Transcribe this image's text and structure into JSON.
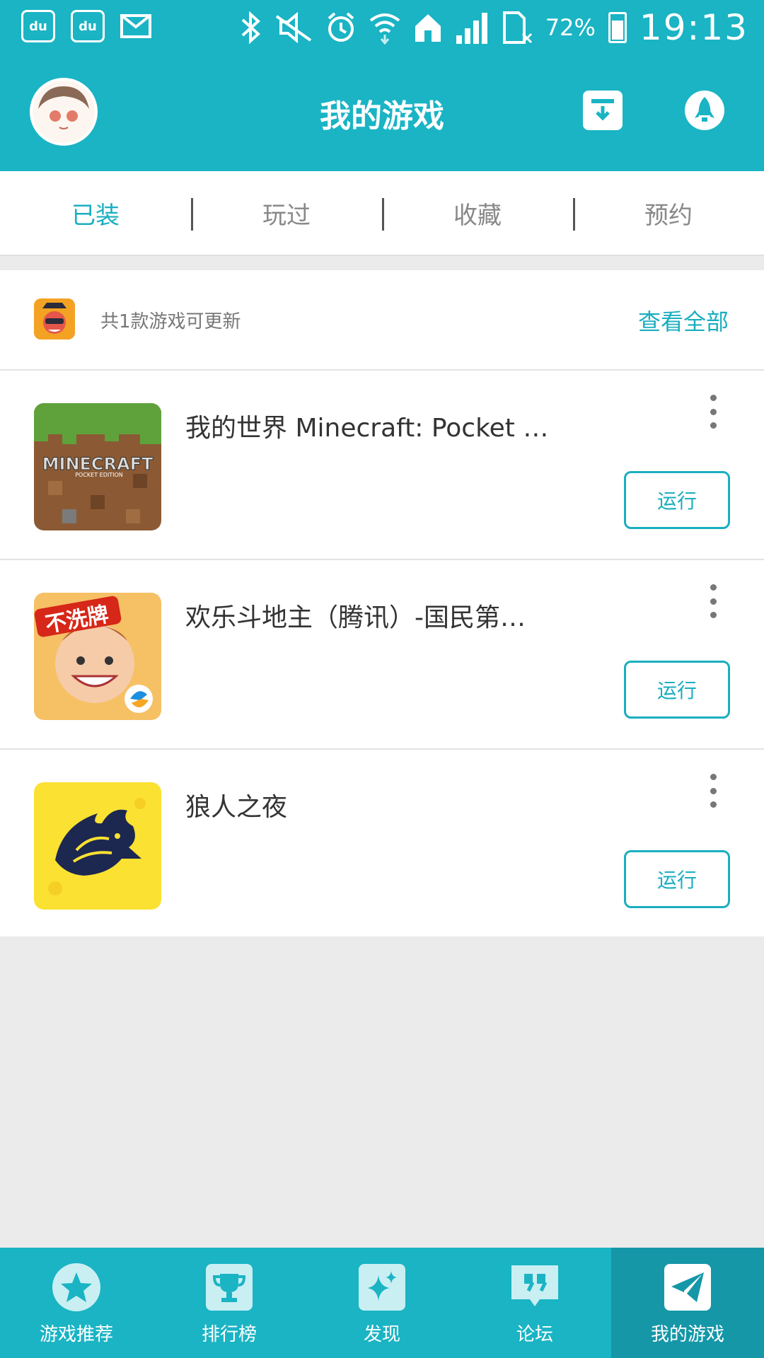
{
  "status_bar": {
    "app_icon_1": "du",
    "app_icon_2": "du",
    "battery_pct": "72%",
    "time": "19:13",
    "icons": [
      "baidu-icon",
      "baidu-icon",
      "mail-icon",
      "bluetooth-icon",
      "mute-icon",
      "alarm-icon",
      "wifi-icon",
      "home-icon",
      "signal-icon",
      "sim-icon",
      "battery-icon"
    ]
  },
  "header": {
    "title": "我的游戏"
  },
  "tabs": [
    {
      "label": "已装",
      "active": true
    },
    {
      "label": "玩过",
      "active": false
    },
    {
      "label": "收藏",
      "active": false
    },
    {
      "label": "预约",
      "active": false
    }
  ],
  "update_banner": {
    "text": "共1款游戏可更新",
    "link": "查看全部"
  },
  "games": [
    {
      "name": "我的世界 Minecraft: Pocket …",
      "run_label": "运行",
      "icon_text": "MINECRAFT",
      "icon_subtext": "POCKET EDITION"
    },
    {
      "name": "欢乐斗地主（腾讯）-国民第…",
      "run_label": "运行",
      "icon_text": "不洗牌"
    },
    {
      "name": "狼人之夜",
      "run_label": "运行"
    }
  ],
  "bottom_nav": [
    {
      "label": "游戏推荐",
      "icon": "star-icon",
      "active": false
    },
    {
      "label": "排行榜",
      "icon": "trophy-icon",
      "active": false
    },
    {
      "label": "发现",
      "icon": "sparkle-icon",
      "active": false
    },
    {
      "label": "论坛",
      "icon": "quote-icon",
      "active": false
    },
    {
      "label": "我的游戏",
      "icon": "paper-plane-icon",
      "active": true
    }
  ],
  "colors": {
    "accent": "#1ab4c4",
    "accent_dark": "#1597a8",
    "link": "#1aaec0",
    "background": "#ebebeb"
  }
}
